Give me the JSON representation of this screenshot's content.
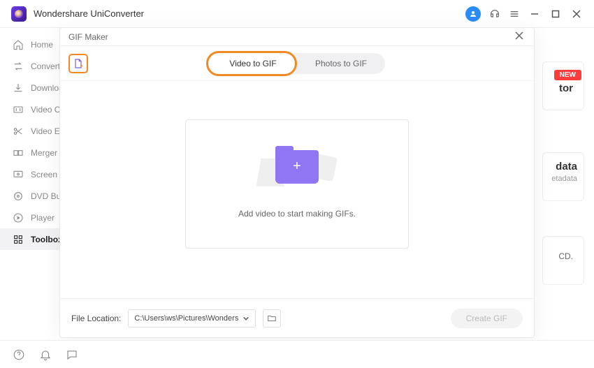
{
  "app": {
    "title": "Wondershare UniConverter"
  },
  "titlebar_icons": {
    "user": "user-icon",
    "headset": "support-icon",
    "menu": "hamburger-icon",
    "minimize": "minimize-icon",
    "maximize": "maximize-icon",
    "close": "close-icon"
  },
  "sidebar": {
    "items": [
      {
        "label": "Home",
        "icon": "home-icon"
      },
      {
        "label": "Converter",
        "icon": "converter-icon"
      },
      {
        "label": "Downloader",
        "icon": "download-icon"
      },
      {
        "label": "Video Compressor",
        "icon": "compress-icon"
      },
      {
        "label": "Video Editor",
        "icon": "scissors-icon"
      },
      {
        "label": "Merger",
        "icon": "merger-icon"
      },
      {
        "label": "Screen Recorder",
        "icon": "record-icon"
      },
      {
        "label": "DVD Burner",
        "icon": "dvd-icon"
      },
      {
        "label": "Player",
        "icon": "play-icon"
      },
      {
        "label": "Toolbox",
        "icon": "toolbox-icon"
      }
    ],
    "active_index": 9
  },
  "content_peek": {
    "new_badge": "NEW",
    "text1": "tor",
    "text2": "data",
    "text3": "etadata",
    "text4": "CD."
  },
  "modal": {
    "title": "GIF Maker",
    "tabs": {
      "video": "Video to GIF",
      "photos": "Photos to GIF",
      "active": "video"
    },
    "drop_text": "Add video to start making GIFs.",
    "footer": {
      "location_label": "File Location:",
      "location_value": "C:\\Users\\ws\\Pictures\\Wonders",
      "create_button": "Create GIF"
    }
  },
  "bottombar": {
    "icons": [
      "help-icon",
      "bell-icon",
      "speech-icon"
    ]
  }
}
